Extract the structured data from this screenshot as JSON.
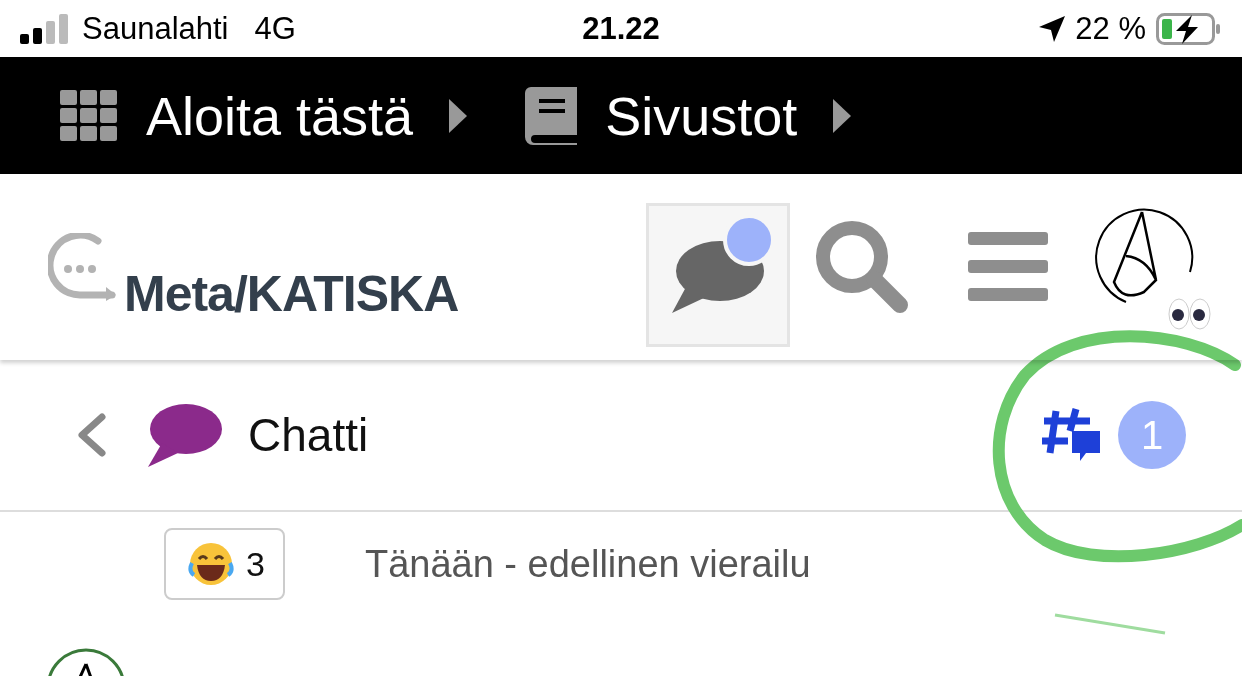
{
  "status_bar": {
    "carrier": "Saunalahti",
    "network": "4G",
    "time": "21.22",
    "battery": "22 %",
    "charging": true
  },
  "top_nav": [
    {
      "kind": "grid",
      "label": "Aloita tästä"
    },
    {
      "kind": "book",
      "label": "Sivustot"
    }
  ],
  "header": {
    "logo_text": "Meta/KATISKA",
    "chat_button": {
      "selected": true,
      "unread": true
    }
  },
  "channel": {
    "title": "Chatti",
    "unread_count": "1"
  },
  "reaction": {
    "count": "3"
  },
  "divider_text": "Tänään - edellinen vierailu"
}
